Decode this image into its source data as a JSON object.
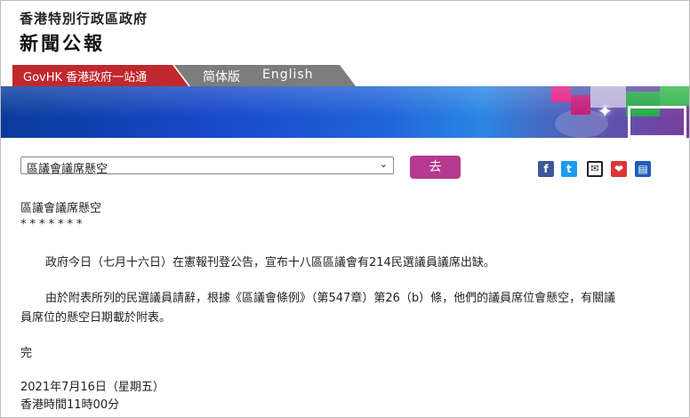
{
  "header": {
    "org_name": "香港特別行政區政府",
    "brand": "新聞公報"
  },
  "nav": {
    "govhk": "GovHK 香港政府一站通",
    "simplified": "简体版",
    "english": "English"
  },
  "banner": {
    "colors": [
      "#0a3b9b",
      "#1f63d8",
      "#e0228a",
      "#2aa84a"
    ]
  },
  "selector": {
    "value": "區議會議席懸空",
    "go_label": "去"
  },
  "share": {
    "facebook_icon": "f",
    "twitter_icon": "t",
    "email_icon": "✉",
    "favourite_icon": "❤",
    "print_icon": "▤"
  },
  "article": {
    "title": "區議會議席懸空",
    "separator": "*******",
    "para1": "政府今日（七月十六日）在憲報刊登公告，宣布十八區區議會有214民選議員議席出缺。",
    "para2_line1": "由於附表所列的民選議員請辭，根據《區議會條例》（第547章）第26（b）條，他們的議員席位會懸空，有關議",
    "para2_line2": "員席位的懸空日期載於附表。",
    "end_mark": "完",
    "date": "2021年7月16日（星期五）",
    "time": "香港時間11時00分"
  }
}
